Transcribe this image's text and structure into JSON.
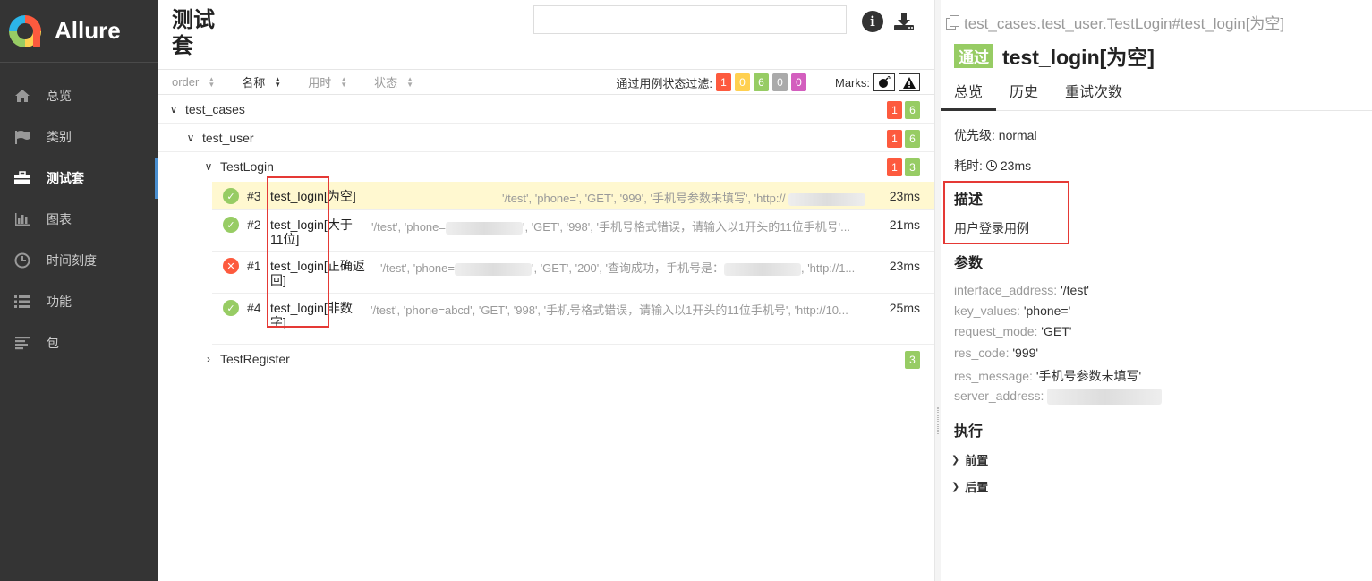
{
  "sidebar": {
    "brand": "Allure",
    "items": [
      {
        "label": "总览",
        "icon": "home-icon"
      },
      {
        "label": "类别",
        "icon": "flag-icon"
      },
      {
        "label": "测试套",
        "icon": "briefcase-icon",
        "active": true
      },
      {
        "label": "图表",
        "icon": "bar-chart-icon"
      },
      {
        "label": "时间刻度",
        "icon": "clock-icon"
      },
      {
        "label": "功能",
        "icon": "list-icon"
      },
      {
        "label": "包",
        "icon": "align-left-icon"
      }
    ]
  },
  "middle": {
    "title": "测试套",
    "search_placeholder": "",
    "sort_columns": [
      "order",
      "名称",
      "用时",
      "状态"
    ],
    "filter_label": "通过用例状态过滤:",
    "filter_counts": [
      "1",
      "0",
      "6",
      "0",
      "0"
    ],
    "marks_label": "Marks:",
    "tree": {
      "suite": {
        "label": "test_cases",
        "failed": "1",
        "passed": "6"
      },
      "module": {
        "label": "test_user",
        "failed": "1",
        "passed": "6"
      },
      "class1": {
        "label": "TestLogin",
        "failed": "1",
        "passed": "3"
      },
      "class2": {
        "label": "TestRegister",
        "passed": "3"
      }
    },
    "cases": [
      {
        "num": "#3",
        "name": "test_login[为空]",
        "params": "'/test', 'phone=', 'GET', '999', '手机号参数未填写', 'http://",
        "time": "23ms",
        "status": "passed"
      },
      {
        "num": "#2",
        "name": "test_login[大于11位]",
        "params_a": "'/test', 'phone=",
        "params_b": "', 'GET', '998', '手机号格式错误，请输入以1开头的11位手机号'...",
        "time": "21ms",
        "status": "passed"
      },
      {
        "num": "#1",
        "name": "test_login[正确返回]",
        "params_a": "'/test', 'phone=",
        "params_b": "', 'GET', '200', '查询成功，手机号是：",
        "params_c": ", 'http://1...",
        "time": "23ms",
        "status": "failed"
      },
      {
        "num": "#4",
        "name": "test_login[非数字]",
        "params": "'/test', 'phone=abcd', 'GET', '998', '手机号格式错误，请输入以1开头的11位手机号', 'http://10...",
        "time": "25ms",
        "status": "passed"
      }
    ]
  },
  "detail": {
    "path": "test_cases.test_user.TestLogin#test_login[为空]",
    "status_badge": "通过",
    "title": "test_login[为空]",
    "tabs": [
      "总览",
      "历史",
      "重试次数"
    ],
    "severity": "优先级: normal",
    "duration_label": "耗时:",
    "duration": "23ms",
    "description_heading": "描述",
    "description": "用户登录用例",
    "params_heading": "参数",
    "params": [
      {
        "key": "interface_address",
        "value": "'/test'"
      },
      {
        "key": "key_values",
        "value": "'phone='"
      },
      {
        "key": "request_mode",
        "value": "'GET'"
      },
      {
        "key": "res_code",
        "value": "'999'"
      },
      {
        "key": "res_message",
        "value": "'手机号参数未填写'"
      },
      {
        "key": "server_address",
        "value": ""
      }
    ],
    "execution_heading": "执行",
    "setup": "前置",
    "teardown": "后置"
  },
  "colors": {
    "sidebar_bg": "#343434",
    "failed": "#fd5a3e",
    "broken": "#ffd050",
    "passed": "#97cc64",
    "skipped": "#aaaaaa",
    "unknown": "#d35ebe",
    "selected_row": "#fff8d0",
    "highlight": "#e53935"
  }
}
